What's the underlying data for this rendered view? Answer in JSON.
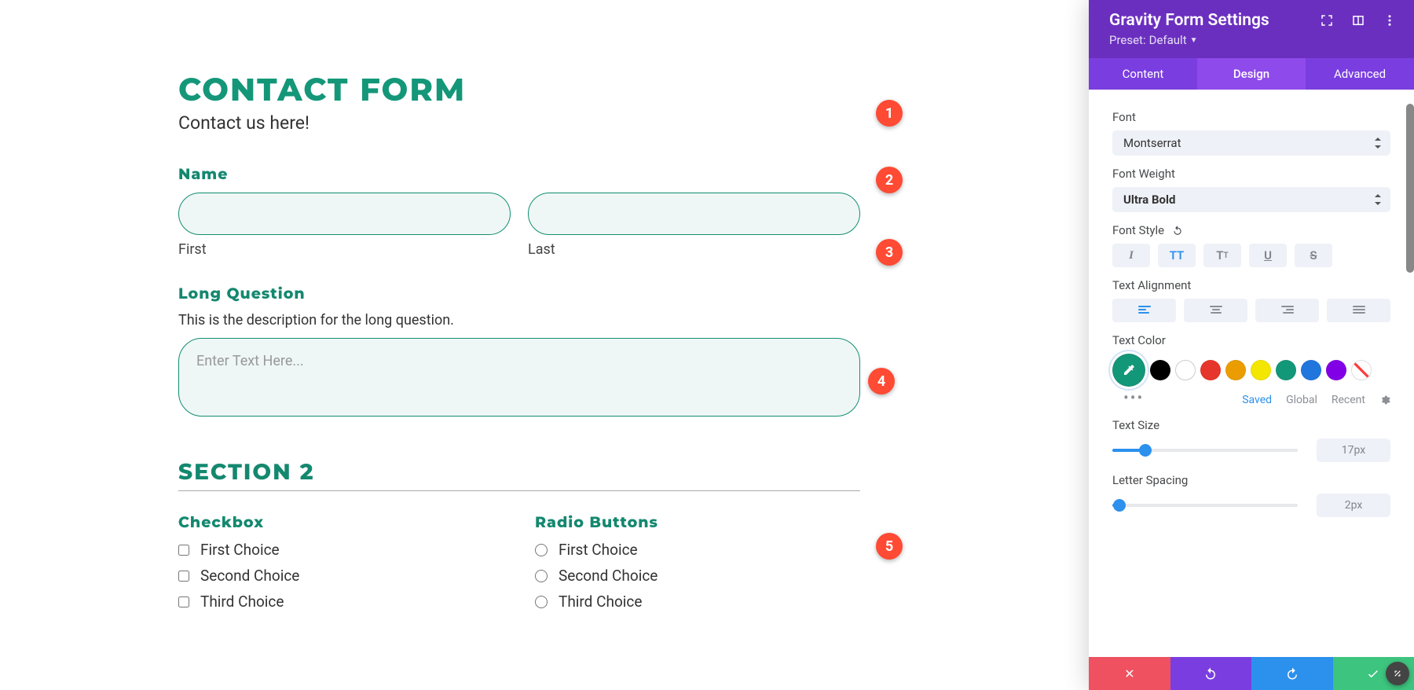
{
  "form": {
    "title": "CONTACT FORM",
    "subtitle": "Contact us here!",
    "name": {
      "label": "Name",
      "first_sub": "First",
      "last_sub": "Last"
    },
    "long": {
      "label": "Long Question",
      "desc": "This is the description for the long question.",
      "placeholder": "Enter Text Here..."
    },
    "section2": {
      "title": "SECTION 2",
      "checkbox_label": "Checkbox",
      "radio_label": "Radio Buttons",
      "choice1": "First Choice",
      "choice2": "Second Choice",
      "choice3": "Third Choice"
    }
  },
  "panel": {
    "title": "Gravity Form Settings",
    "preset_prefix": "Preset: ",
    "preset_value": "Default",
    "tabs": {
      "content": "Content",
      "design": "Design",
      "advanced": "Advanced"
    },
    "font": {
      "label": "Font",
      "value": "Montserrat"
    },
    "weight": {
      "label": "Font Weight",
      "value": "Ultra Bold"
    },
    "style": {
      "label": "Font Style"
    },
    "align": {
      "label": "Text Alignment"
    },
    "textcolor": {
      "label": "Text Color",
      "selected": "#139779"
    },
    "color_tabs": {
      "saved": "Saved",
      "global": "Global",
      "recent": "Recent"
    },
    "textsize": {
      "label": "Text Size",
      "value": "17px"
    },
    "letter": {
      "label": "Letter Spacing",
      "value": "2px"
    },
    "swatches": {
      "black": "#000000",
      "white": "#ffffff",
      "red": "#e6352b",
      "orange": "#eb9d00",
      "yellow": "#f3e600",
      "green": "#139779",
      "blue": "#2176de",
      "purple": "#8200e6"
    }
  },
  "badges": {
    "b1": "1",
    "b2": "2",
    "b3": "3",
    "b4": "4",
    "b5": "5"
  }
}
